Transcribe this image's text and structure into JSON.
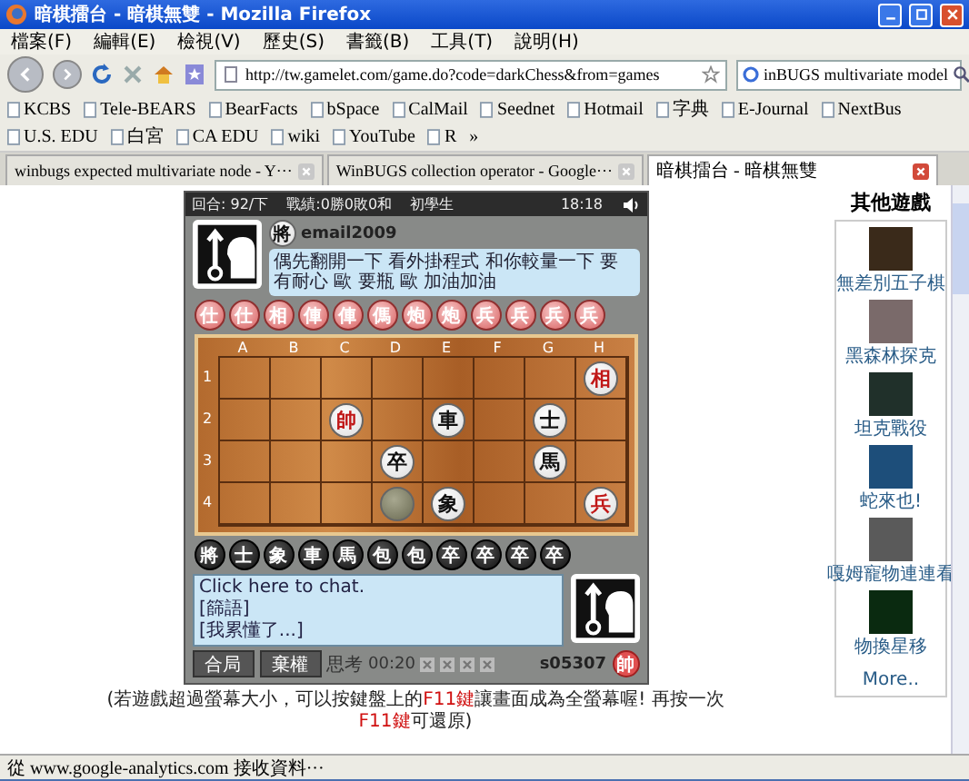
{
  "window": {
    "title": "暗棋擂台 - 暗棋無雙 - Mozilla Firefox"
  },
  "menu": [
    "檔案(F)",
    "編輯(E)",
    "檢視(V)",
    "歷史(S)",
    "書籤(B)",
    "工具(T)",
    "說明(H)"
  ],
  "address_bar": {
    "value": "http://tw.gamelet.com/game.do?code=darkChess&from=games"
  },
  "search": {
    "value": "inBUGS multivariate model"
  },
  "bookmarks": [
    {
      "label": "KCBS"
    },
    {
      "label": "Tele-BEARS"
    },
    {
      "label": "BearFacts"
    },
    {
      "label": "bSpace"
    },
    {
      "label": "CalMail"
    },
    {
      "label": "Seednet"
    },
    {
      "label": "Hotmail"
    },
    {
      "label": "字典"
    },
    {
      "label": "E-Journal"
    },
    {
      "label": "NextBus"
    },
    {
      "label": "U.S. EDU"
    },
    {
      "label": "白宮"
    },
    {
      "label": "CA EDU"
    },
    {
      "label": "wiki"
    },
    {
      "label": "YouTube"
    },
    {
      "label": "R"
    }
  ],
  "bookmarks_overflow": "»",
  "tabs": [
    {
      "label": "winbugs expected multivariate node - Y···",
      "selected": false
    },
    {
      "label": "WinBUGS collection operator - Google···",
      "selected": false
    },
    {
      "label": "暗棋擂台 - 暗棋無雙",
      "selected": true
    }
  ],
  "game": {
    "header": {
      "round": "回合: 92/下",
      "record": "戰績:0勝0敗0和",
      "rank": "初學生",
      "time": "18:18"
    },
    "opponent": {
      "badge": "將",
      "name": "email2009",
      "message": "偶先翻開一下 看外掛程式 和你較量一下 要有耐心 歐 要瓶 歐 加油加油"
    },
    "captured_top": [
      "仕",
      "仕",
      "相",
      "俥",
      "俥",
      "傌",
      "炮",
      "炮",
      "兵",
      "兵",
      "兵",
      "兵"
    ],
    "columns": [
      "A",
      "B",
      "C",
      "D",
      "E",
      "F",
      "G",
      "H"
    ],
    "rows": [
      {
        "label": "1",
        "cells": [
          {
            "kind": "empty"
          },
          {
            "kind": "empty"
          },
          {
            "kind": "empty"
          },
          {
            "kind": "empty"
          },
          {
            "kind": "empty"
          },
          {
            "kind": "empty"
          },
          {
            "kind": "empty"
          },
          {
            "kind": "red",
            "piece": "相"
          }
        ]
      },
      {
        "label": "2",
        "cells": [
          {
            "kind": "empty"
          },
          {
            "kind": "empty"
          },
          {
            "kind": "red",
            "piece": "帥"
          },
          {
            "kind": "empty"
          },
          {
            "kind": "black",
            "piece": "車"
          },
          {
            "kind": "empty"
          },
          {
            "kind": "black",
            "piece": "士"
          },
          {
            "kind": "empty"
          }
        ]
      },
      {
        "label": "3",
        "cells": [
          {
            "kind": "empty"
          },
          {
            "kind": "empty"
          },
          {
            "kind": "empty"
          },
          {
            "kind": "black",
            "piece": "卒"
          },
          {
            "kind": "empty"
          },
          {
            "kind": "empty"
          },
          {
            "kind": "black",
            "piece": "馬"
          },
          {
            "kind": "empty"
          }
        ]
      },
      {
        "label": "4",
        "cells": [
          {
            "kind": "empty"
          },
          {
            "kind": "empty"
          },
          {
            "kind": "empty"
          },
          {
            "kind": "hidden"
          },
          {
            "kind": "black",
            "piece": "象"
          },
          {
            "kind": "empty"
          },
          {
            "kind": "empty"
          },
          {
            "kind": "red",
            "piece": "兵"
          }
        ]
      }
    ],
    "captured_bottom": [
      "將",
      "士",
      "象",
      "車",
      "馬",
      "包",
      "包",
      "卒",
      "卒",
      "卒",
      "卒"
    ],
    "chat_lines": [
      "Click here to chat.",
      "[篩語]",
      "[我累懂了...]"
    ],
    "buttons": [
      "合局",
      "棄權"
    ],
    "think_label": "思考",
    "timer": "00:20",
    "player_id": "s05307",
    "player_badge": "帥"
  },
  "footer_note": [
    {
      "kind": "plain",
      "text": "(若遊戲超過螢幕大小，可以按鍵盤上的"
    },
    {
      "kind": "key",
      "text": "F11鍵"
    },
    {
      "kind": "plain",
      "text": "讓畫面成為全螢幕喔! 再按一次"
    },
    {
      "kind": "key",
      "text": "F11鍵"
    },
    {
      "kind": "plain",
      "text": "可還原)"
    }
  ],
  "sidebar": {
    "title": "其他遊戲",
    "items": [
      "無差別五子棋",
      "黑森林探克",
      "坦克戰役",
      "蛇來也!",
      "嘎姆寵物連連看",
      "物換星移"
    ],
    "more": "More.."
  },
  "status_bar": "從 www.google-analytics.com 接收資料···"
}
